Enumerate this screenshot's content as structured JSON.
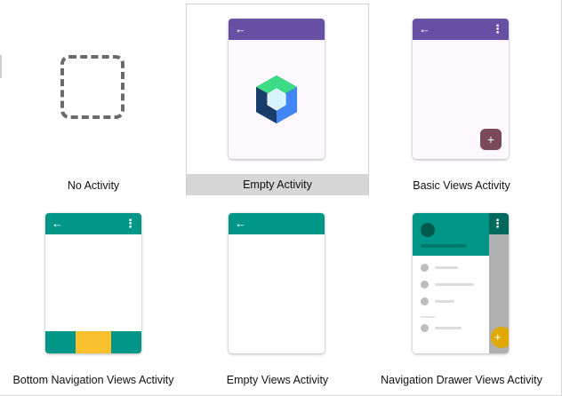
{
  "templates": [
    {
      "label": "No Activity"
    },
    {
      "label": "Empty Activity",
      "selected": true
    },
    {
      "label": "Basic Views Activity"
    },
    {
      "label": "Bottom Navigation Views Activity"
    },
    {
      "label": "Empty Views Activity"
    },
    {
      "label": "Navigation Drawer Views Activity"
    }
  ],
  "icons": {
    "back": "←",
    "overflow": "⋮",
    "add": "+"
  },
  "colors": {
    "purple_appbar": "#6750a4",
    "teal_appbar": "#009688",
    "fab_purple": "#7b4a5a",
    "bottom_nav_selected": "#fbc02d",
    "drawer_fab": "#e0a800",
    "selection_label_bg": "#d6d6d6"
  }
}
